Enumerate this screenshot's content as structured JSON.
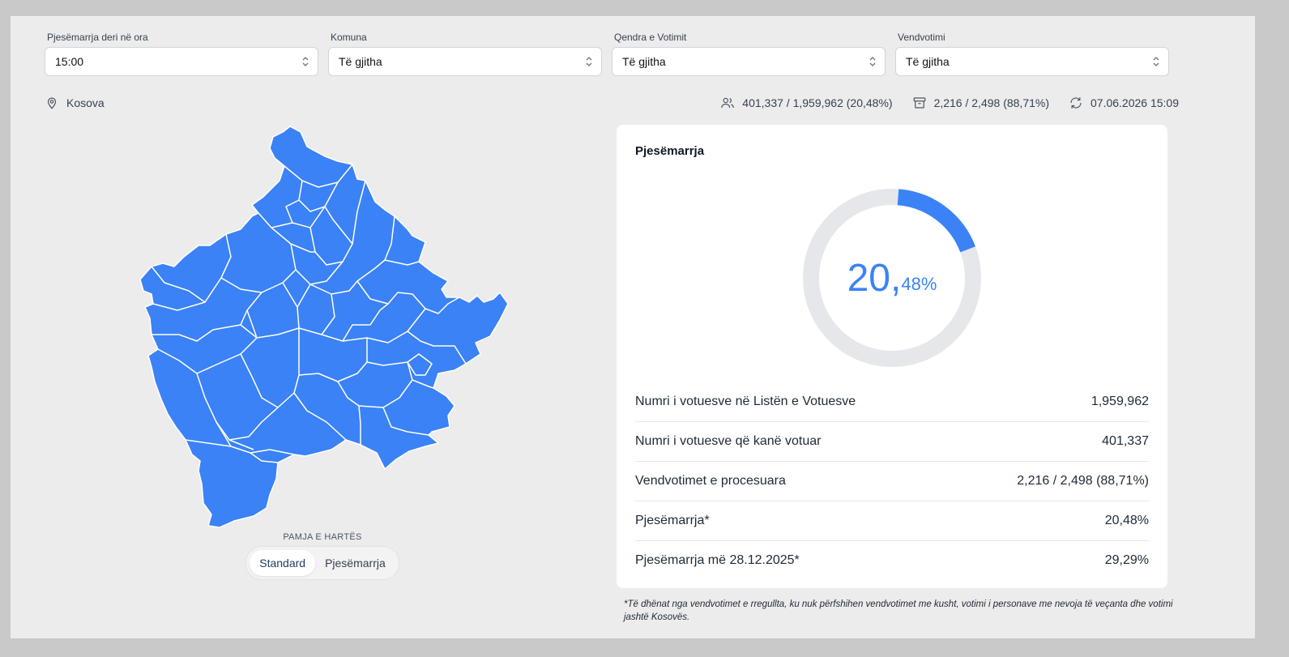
{
  "filters": [
    {
      "label": "Pjesëmarrja deri në ora",
      "value": "15:00"
    },
    {
      "label": "Komuna",
      "value": "Të gjitha"
    },
    {
      "label": "Qendra e Votimit",
      "value": "Të gjitha"
    },
    {
      "label": "Vendvotimi",
      "value": "Të gjitha"
    }
  ],
  "location": {
    "icon": "map-pin-icon",
    "label": "Kosova"
  },
  "stats": {
    "voters": {
      "icon": "users-icon",
      "text": "401,337 / 1,959,962 (20,48%)"
    },
    "stations": {
      "icon": "archive-icon",
      "text": "2,216 / 2,498 (88,71%)"
    },
    "updated": {
      "icon": "refresh-icon",
      "text": "07.06.2026 15:09"
    }
  },
  "map_view": {
    "label": "PAMJA E HARTËS",
    "options": [
      "Standard",
      "Pjesëmarrja"
    ],
    "selected": "Standard"
  },
  "turnout_card": {
    "title": "Pjesëmarrja",
    "gauge_percent": 20.48,
    "big_value": "20,",
    "small_value": "48%",
    "rows": [
      {
        "label": "Numri i votuesve në Listën e Votuesve",
        "value": "1,959,962"
      },
      {
        "label": "Numri i votuesve që kanë votuar",
        "value": "401,337"
      },
      {
        "label": "Vendvotimet e procesuara",
        "value": "2,216 / 2,498 (88,71%)"
      },
      {
        "label": "Pjesëmarrja*",
        "value": "20,48%"
      },
      {
        "label": "Pjesëmarrja më 28.12.2025*",
        "value": "29,29%"
      }
    ]
  },
  "footnote": "*Të dhënat nga vendvotimet e rregullta, ku nuk përfshihen vendvotimet me kusht, votimi i personave me nevoja të veçanta dhe votimi jashtë Kosovës.",
  "colors": {
    "accent": "#3b82f6",
    "track": "#e5e7eb",
    "map_fill": "#3b82f6"
  }
}
